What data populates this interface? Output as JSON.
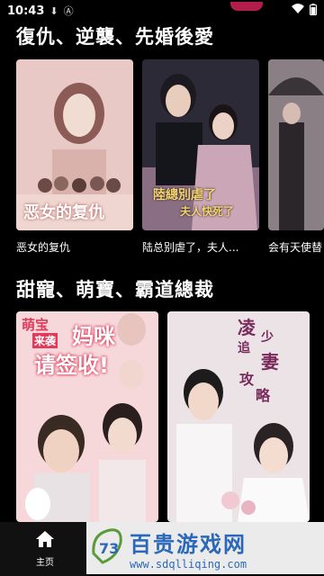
{
  "status_bar": {
    "time": "10:43"
  },
  "sections": [
    {
      "title": "復仇、逆襲、先婚後愛",
      "items": [
        {
          "title": "恶女的复仇",
          "poster_text": "恶女的复仇"
        },
        {
          "title": "陆总别虐了，夫人...",
          "poster_text_1": "陸總別虐了",
          "poster_text_2": "夫人快死了"
        },
        {
          "title": "会有天使替"
        }
      ]
    },
    {
      "title": "甜寵、萌寶、霸道總裁",
      "items": [
        {
          "poster_text_1": "萌宝",
          "poster_text_2": "来袭",
          "poster_text_3": "妈咪",
          "poster_text_4": "请签收!"
        },
        {
          "poster_text_1": "凌",
          "poster_text_2": "少",
          "poster_text_3": "追",
          "poster_text_4": "妻",
          "poster_text_5": "攻",
          "poster_text_6": "略"
        }
      ]
    }
  ],
  "bottom_nav": {
    "home_label": "主页"
  },
  "watermark": {
    "text": "百贵游戏网",
    "url": "www.sdqlliqing.com"
  }
}
